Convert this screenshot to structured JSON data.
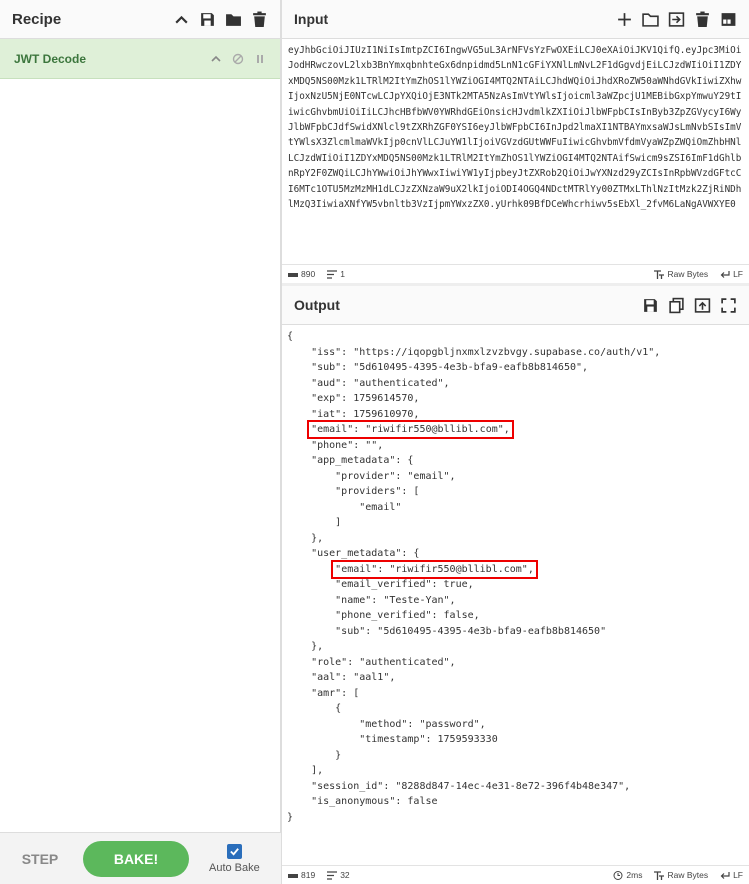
{
  "recipe": {
    "title": "Recipe",
    "icons": [
      "chevron-up-icon",
      "save-icon",
      "folder-icon",
      "trash-icon"
    ],
    "operations": [
      {
        "name": "JWT Decode",
        "icons": [
          "chevron-up-icon",
          "disable-icon",
          "pause-icon"
        ]
      }
    ],
    "step_label": "STEP",
    "bake_label": "BAKE!",
    "auto_bake_label": "Auto Bake",
    "auto_bake_checked": true
  },
  "input": {
    "title": "Input",
    "text": "eyJhbGciOiJIUzI1NiIsImtpZCI6IngwVG5uL3ArNFVsYzFwOXEiLCJ0eXAiOiJKV1QifQ.eyJpc3MiOiJodHRwczovL2lxb3BnYmxqbnhteGx6dnpidmd5LnN1cGFiYXNlLmNvL2F1dGgvdjEiLCJzdWIiOiI1ZDYxMDQ5NS00Mzk1LTRlM2ItYmZhOS1lYWZiOGI4MTQ2NTAiLCJhdWQiOiJhdXRoZW50aWNhdGVkIiwiZXhwIjoxNzU5NjE0NTcwLCJpYXQiOjE3NTk2MTA5NzAsImVtYWlsIjoicml3aWZpcjU1MEBibGxpYmwuY29tIiwicGhvbmUiOiIiLCJhcHBfbWV0YWRhdGEiOnsicHJvdmlkZXIiOiJlbWFpbCIsInByb3ZpZGVycyI6WyJlbWFpbCJdfSwidXNlcl9tZXRhZGF0YSI6eyJlbWFpbCI6InJpd2lmaXI1NTBAYmxsaWJsLmNvbSIsImVtYWlsX3ZlcmlmaWVkIjp0cnVlLCJuYW1lIjoiVGVzdGUtWWFuIiwicGhvbmVfdmVyaWZpZWQiOmZhbHNlLCJzdWIiOiI1ZDYxMDQ5NS00Mzk1LTRlM2ItYmZhOS1lYWZiOGI4MTQ2NTAifSwicm9sZSI6ImF1dGhlbnRpY2F0ZWQiLCJhYWwiOiJhYWwxIiwiYW1yIjpbeyJtZXRob2QiOiJwYXNzd29yZCIsInRpbWVzdGFtcCI6MTc1OTU5MzMzMH1dLCJzZXNzaW9uX2lkIjoiODI4OGQ4NDctMTRlYy00ZTMxLThlNzItMzk2ZjRiNDhlMzQ3IiwiaXNfYW5vbnltb3VzIjpmYWxzZX0.yUrhk09BfDCeWhcrhiwv5sEbXl_2fvM6LaNgAVWXYE0",
    "status": {
      "chars": "890",
      "lines": "1",
      "encoding": "Raw Bytes",
      "eol": "LF"
    }
  },
  "output": {
    "title": "Output",
    "status": {
      "chars": "819",
      "lines": "32",
      "time": "2ms",
      "encoding": "Raw Bytes",
      "eol": "LF"
    }
  },
  "json_lines": [
    "{",
    "    \"iss\": \"https://iqopgbljnxmxlzvzbvgy.supabase.co/auth/v1\",",
    "    \"sub\": \"5d610495-4395-4e3b-bfa9-eafb8b814650\",",
    "    \"aud\": \"authenticated\",",
    "    \"exp\": 1759614570,",
    "    \"iat\": 1759610970,",
    "    \"email\": \"riwifir550@bllibl.com\",",
    "    \"phone\": \"\",",
    "    \"app_metadata\": {",
    "        \"provider\": \"email\",",
    "        \"providers\": [",
    "            \"email\"",
    "        ]",
    "    },",
    "    \"user_metadata\": {",
    "        \"email\": \"riwifir550@bllibl.com\",",
    "        \"email_verified\": true,",
    "        \"name\": \"Teste-Yan\",",
    "        \"phone_verified\": false,",
    "        \"sub\": \"5d610495-4395-4e3b-bfa9-eafb8b814650\"",
    "    },",
    "    \"role\": \"authenticated\",",
    "    \"aal\": \"aal1\",",
    "    \"amr\": [",
    "        {",
    "            \"method\": \"password\",",
    "            \"timestamp\": 1759593330",
    "        }",
    "    ],",
    "    \"session_id\": \"8288d847-14ec-4e31-8e72-396f4b48e347\",",
    "    \"is_anonymous\": false",
    "}"
  ]
}
